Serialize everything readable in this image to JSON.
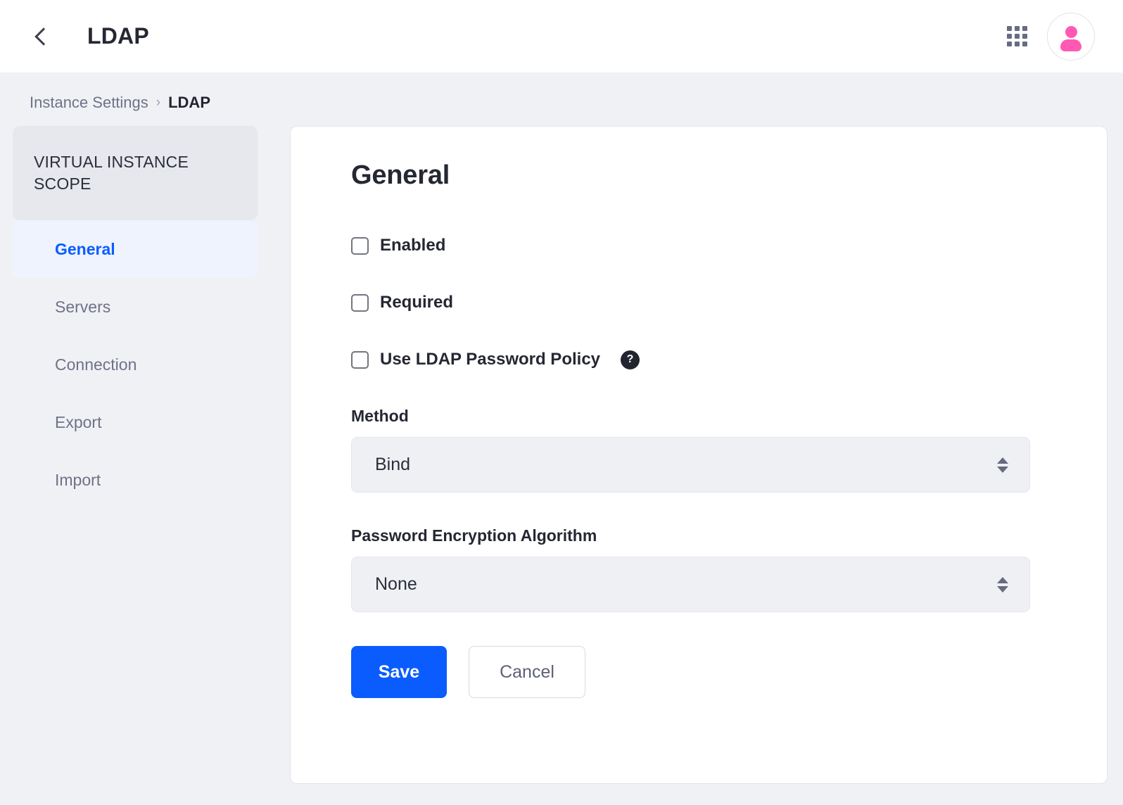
{
  "header": {
    "back_icon": "chevron-left-icon",
    "title": "LDAP",
    "grid_icon": "apps-grid-icon",
    "avatar_icon": "user-avatar-icon"
  },
  "breadcrumb": {
    "parent": "Instance Settings",
    "separator": "›",
    "current": "LDAP"
  },
  "sidebar": {
    "scope_label": "VIRTUAL INSTANCE SCOPE",
    "items": [
      {
        "label": "General",
        "active": true
      },
      {
        "label": "Servers",
        "active": false
      },
      {
        "label": "Connection",
        "active": false
      },
      {
        "label": "Export",
        "active": false
      },
      {
        "label": "Import",
        "active": false
      }
    ]
  },
  "main": {
    "title": "General",
    "checkboxes": [
      {
        "label": "Enabled",
        "checked": false,
        "help": false
      },
      {
        "label": "Required",
        "checked": false,
        "help": false
      },
      {
        "label": "Use LDAP Password Policy",
        "checked": false,
        "help": true,
        "help_glyph": "?"
      }
    ],
    "fields": [
      {
        "label": "Method",
        "value": "Bind"
      },
      {
        "label": "Password Encryption Algorithm",
        "value": "None"
      }
    ],
    "buttons": {
      "save": "Save",
      "cancel": "Cancel"
    }
  },
  "colors": {
    "accent_blue": "#0b5cff",
    "active_nav_bg": "#eef3fe",
    "page_bg": "#f0f1f5",
    "avatar_pink": "#ff59b4",
    "help_badge": "#22242e"
  }
}
